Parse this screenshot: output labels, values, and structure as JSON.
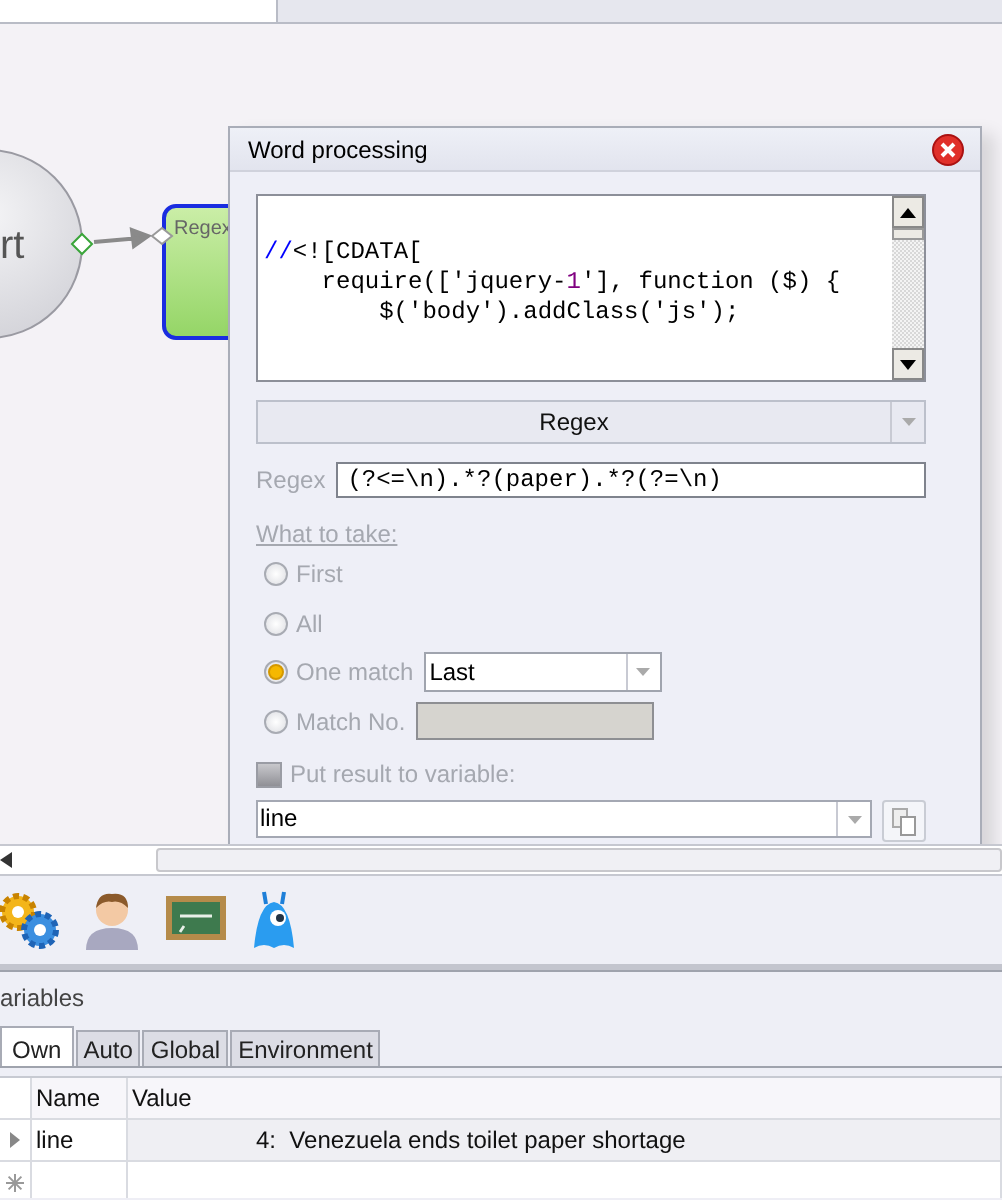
{
  "canvas": {
    "nodes": [
      {
        "kind": "start",
        "label": "rt"
      },
      {
        "kind": "action",
        "label": "Regex"
      }
    ]
  },
  "dialog": {
    "title": "Word processing",
    "code_lines": [
      [
        {
          "text": "//",
          "color": "#0000ff"
        },
        {
          "text": "<![CDATA["
        }
      ],
      [
        {
          "text": "    require(['jquery-"
        },
        {
          "text": "1",
          "color": "#800080"
        },
        {
          "text": "'], function ($) {"
        }
      ],
      [
        {
          "text": "        $('body').addClass('js');"
        }
      ]
    ],
    "mode": "Regex",
    "regex_label": "Regex",
    "regex_value": "(?<=\\n).*?(paper).*?(?=\\n)",
    "section_label": "What to take:",
    "options": [
      {
        "kind": "plain",
        "label": "First",
        "selected": false
      },
      {
        "kind": "plain",
        "label": "All",
        "selected": false
      },
      {
        "kind": "combo",
        "label": "One match",
        "selected": true,
        "value": "Last"
      },
      {
        "kind": "field",
        "label": "Match No.",
        "selected": false
      }
    ],
    "put_result": {
      "label": "Put result to variable:",
      "checked": false
    },
    "variable": "line"
  },
  "variables": {
    "title": "ariables",
    "tabs": [
      {
        "label": "Own",
        "selected": true
      },
      {
        "label": "Auto",
        "selected": false
      },
      {
        "label": "Global",
        "selected": false
      },
      {
        "label": "Environment",
        "selected": false
      }
    ],
    "columns": [
      "Name",
      "Value"
    ],
    "rows": [
      {
        "name": "line",
        "value": "4:  Venezuela ends toilet paper shortage",
        "selected": true
      }
    ]
  }
}
